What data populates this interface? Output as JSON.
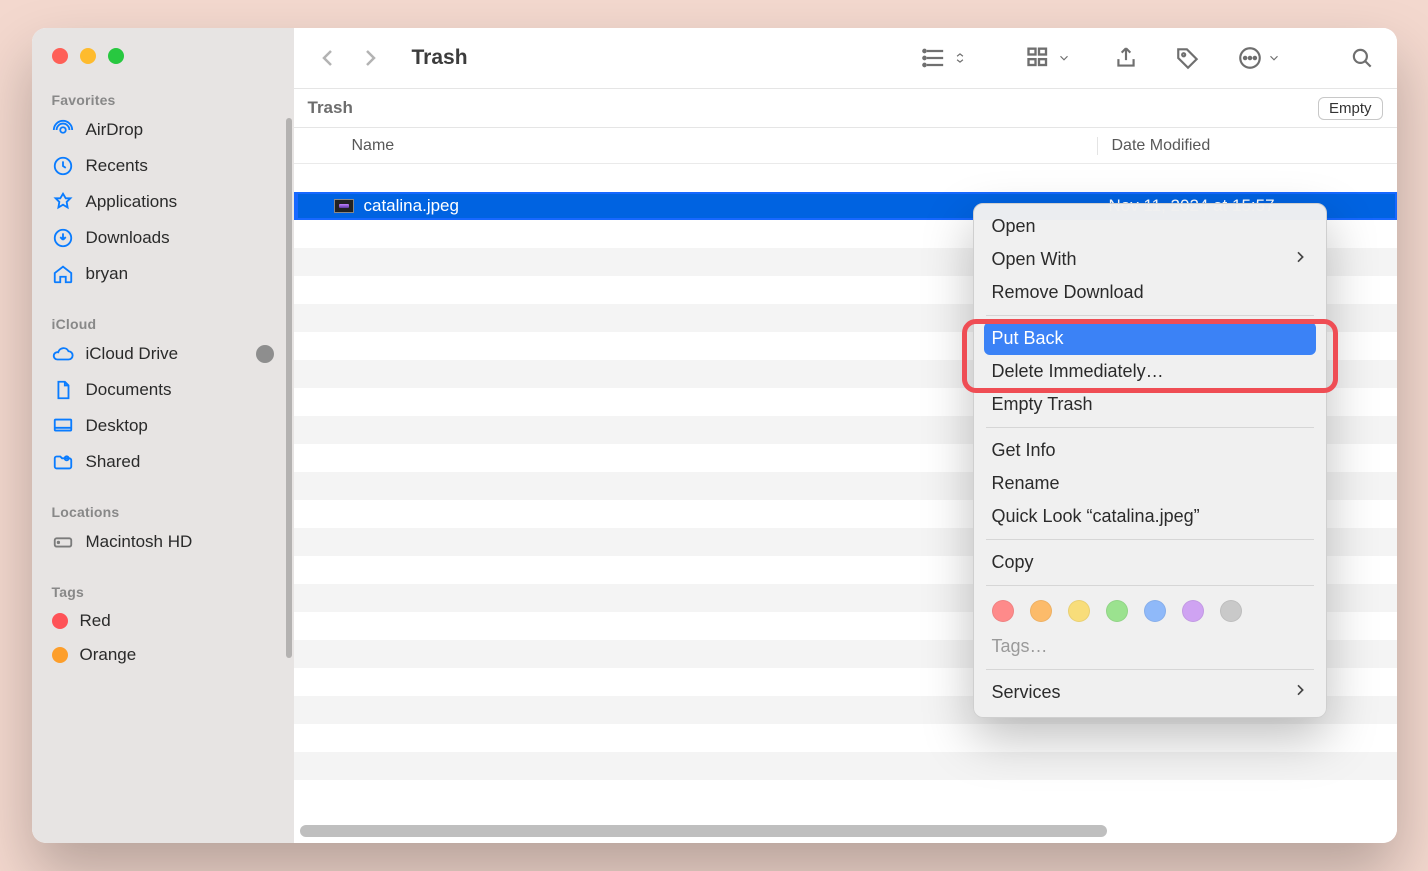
{
  "window": {
    "title": "Trash"
  },
  "pathbar": {
    "label": "Trash",
    "empty_btn": "Empty"
  },
  "columns": {
    "name": "Name",
    "date": "Date Modified"
  },
  "files": [
    {
      "name": "catalina.jpeg",
      "date": "Nov 11, 2024 at 15:57"
    }
  ],
  "sidebar": {
    "favorites_label": "Favorites",
    "favorites": [
      {
        "label": "AirDrop"
      },
      {
        "label": "Recents"
      },
      {
        "label": "Applications"
      },
      {
        "label": "Downloads"
      },
      {
        "label": "bryan"
      }
    ],
    "icloud_label": "iCloud",
    "icloud": [
      {
        "label": "iCloud Drive"
      },
      {
        "label": "Documents"
      },
      {
        "label": "Desktop"
      },
      {
        "label": "Shared"
      }
    ],
    "locations_label": "Locations",
    "locations": [
      {
        "label": "Macintosh HD"
      }
    ],
    "tags_label": "Tags",
    "tags": [
      {
        "label": "Red",
        "color": "#fe5257"
      },
      {
        "label": "Orange",
        "color": "#fd9e2b"
      }
    ]
  },
  "ctx": {
    "open": "Open",
    "open_with": "Open With",
    "remove_download": "Remove Download",
    "put_back": "Put Back",
    "delete_immediately": "Delete Immediately…",
    "empty_trash": "Empty Trash",
    "get_info": "Get Info",
    "rename": "Rename",
    "quick_look": "Quick Look “catalina.jpeg”",
    "copy": "Copy",
    "tags": "Tags…",
    "services": "Services",
    "tag_colors": [
      "#fe8a8a",
      "#fcbb6a",
      "#f8dd7a",
      "#9be28f",
      "#8fb9f9",
      "#cfa3f2",
      "#c9c9c9"
    ]
  }
}
